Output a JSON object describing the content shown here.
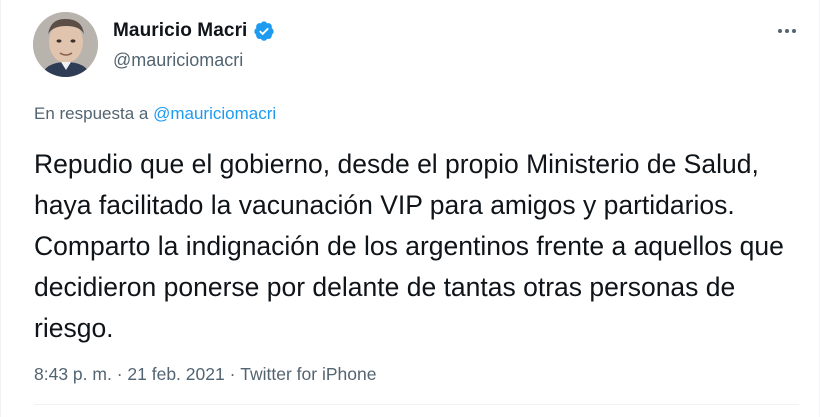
{
  "author": {
    "display_name": "Mauricio Macri",
    "handle": "@mauriciomacri",
    "verified": true
  },
  "reply": {
    "prefix": "En respuesta a",
    "handle": "@mauriciomacri"
  },
  "tweet": {
    "text": "Repudio que el gobierno, desde el propio Ministerio de Salud, haya facilitado la vacunación VIP para amigos y partidarios. Comparto la indignación de los argentinos frente a aquellos que decidieron ponerse por delante de tantas otras personas de riesgo."
  },
  "meta": {
    "time": "8:43 p. m.",
    "sep1": " · ",
    "date": "21 feb. 2021",
    "sep2": " · ",
    "source": "Twitter for iPhone"
  },
  "icons": {
    "verified": "verified-badge-icon",
    "more": "more-options-icon"
  },
  "colors": {
    "accent": "#1d9bf0",
    "secondary_text": "#536471",
    "primary_text": "#0f1419"
  }
}
